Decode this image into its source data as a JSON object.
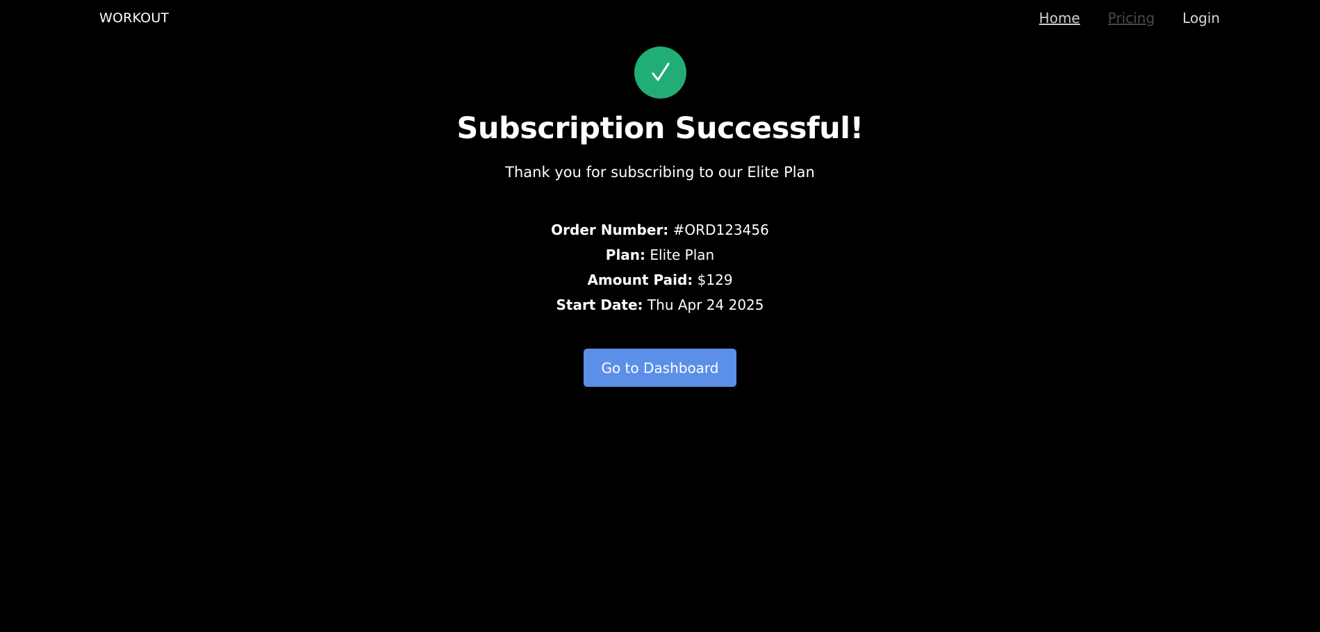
{
  "navbar": {
    "brand": "WORKOUT",
    "links": [
      {
        "label": "Home"
      },
      {
        "label": "Pricing"
      },
      {
        "label": "Login"
      }
    ]
  },
  "confirmation": {
    "icon": "check-icon",
    "title": "Subscription Successful!",
    "subtitle": "Thank you for subscribing to our Elite Plan",
    "details": [
      {
        "label": "Order Number:",
        "value": "#ORD123456"
      },
      {
        "label": "Plan:",
        "value": "Elite Plan"
      },
      {
        "label": "Amount Paid:",
        "value": "$129"
      },
      {
        "label": "Start Date:",
        "value": "Thu Apr 24 2025"
      }
    ],
    "button_label": "Go to Dashboard"
  },
  "colors": {
    "background": "#000000",
    "success": "#22ad76",
    "button": "#5b8fe8"
  }
}
